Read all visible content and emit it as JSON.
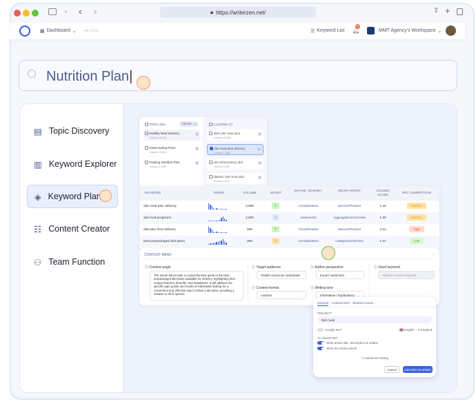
{
  "browser": {
    "url": "https://writerzen.net/"
  },
  "header": {
    "dashboard": "Dashboard",
    "version": "ver. 2.0.0",
    "keyword_list": "Keyword List",
    "keyword_list_count": "12",
    "notif_count": "12",
    "workspace": "MMT Agency's Workspace"
  },
  "search": {
    "value": "Nutrition Plan"
  },
  "sidebar": {
    "items": [
      {
        "label": "Topic Discovery",
        "icon": "topic-discovery-icon"
      },
      {
        "label": "Keyword Explorer",
        "icon": "keyword-explorer-icon"
      },
      {
        "label": "Keyword Plan",
        "icon": "layers-icon"
      },
      {
        "label": "Content Creator",
        "icon": "content-creator-icon"
      },
      {
        "label": "Team Function",
        "icon": "team-icon"
      }
    ]
  },
  "topics": {
    "header": "TOPIC (50)",
    "sort": "Volume",
    "count": "47",
    "items": [
      {
        "name": "Healthy Meal Delivery",
        "volume": "Volume: 28,131"
      },
      {
        "name": "Clean Eating Plans",
        "volume": "Volume: 18,631"
      },
      {
        "name": "Training Nutrition Plan",
        "volume": "Volume: 10,540"
      }
    ]
  },
  "clusters": {
    "header": "CLUSTER (7)",
    "items": [
      {
        "name": "dash diet meal plan",
        "volume": "Volume: 15,634",
        "checked": false
      },
      {
        "name": "diet meal plan delivery",
        "volume": "Volume: 7,298",
        "checked": true
      },
      {
        "name": "anti inflammatory diet",
        "volume": "Volume: 4,298",
        "checked": false
      },
      {
        "name": "diabetic diet meal plan",
        "volume": "Volume: 1,210",
        "checked": false
      }
    ]
  },
  "table": {
    "headers": [
      "KEYWORD",
      "TREND",
      "VOLUME",
      "INTENT",
      "BUYING JOURNEY",
      "MICRO INTENT",
      "GOLDEN SCORE",
      "PPC COMPETITION"
    ],
    "rows": [
      {
        "keyword": "diet meal plan delivery",
        "trend": [
          9,
          7,
          5,
          2,
          1,
          2,
          1,
          1,
          1,
          1,
          1,
          1
        ],
        "volume": "3,880",
        "intent": "T",
        "journey": "Consideration",
        "micro": "Service/Product",
        "score": "1.43",
        "ppc": "Medium"
      },
      {
        "keyword": "diet food programs",
        "trend": [
          1,
          1,
          1,
          1,
          1,
          1,
          1,
          2,
          5,
          7,
          4,
          2
        ],
        "volume": "2,500",
        "intent": "I",
        "journey": "Awareness",
        "micro": "Aggregation/Overview",
        "score": "1.25",
        "ppc": "Medium"
      },
      {
        "keyword": "diet plan food delivery",
        "trend": [
          9,
          7,
          5,
          2,
          1,
          2,
          1,
          1,
          1,
          1,
          1,
          1
        ],
        "volume": "590",
        "intent": "T",
        "journey": "Consideration",
        "micro": "Service/Product",
        "score": "2.01",
        "ppc": "High"
      },
      {
        "keyword": "best prepackaged diet plans",
        "trend": [
          1,
          2,
          2,
          3,
          3,
          4,
          4,
          5,
          6,
          8,
          5,
          3
        ],
        "volume": "260",
        "intent": "C",
        "journey": "Consideration",
        "micro": "Category/Selection",
        "score": "1.07",
        "ppc": "Low"
      }
    ]
  },
  "colors": {
    "accent": "#3b63e0",
    "intent_T": "#c9f5c0",
    "intent_I": "#d8e5fb",
    "intent_C": "#ffe0a3",
    "ppc_Medium": "#ffe0a3",
    "ppc_High": "#ffd9d0",
    "ppc_Low": "#d6f7cf"
  },
  "brief": {
    "title": "CONTENT BRIEF",
    "angle_label": "Content angle",
    "angle": "The article will provide a comprehensive guide to the best prepackaged diet plans available for delivery, highlighting their unique features, benefits, and drawbacks. It will address the specific pain points and needs of individuals looking for a convenient and effective way to follow a diet plan, providing a solution to their queries.",
    "audience_label": "Target audience",
    "audience": "Health-conscious individuals",
    "perspective_label": "Author perspective",
    "perspective": "Expert nutritionist",
    "seed_label": "Seed keyword",
    "seed_placeholder": "Highest-volume keyword",
    "format_label": "Content format",
    "format": "Listicles",
    "tone_label": "Writing tone",
    "tone": "Informative / Explanatory"
  },
  "popup": {
    "tabs": [
      "General",
      "Content brief",
      "Shared Access"
    ],
    "project_label": "PROJECT",
    "project": "Diet meal",
    "nlp": "Google NLP",
    "language": "English",
    "region": "England",
    "ai_label": "AI ASSISTANT",
    "opt1": "Write article title, description & outline",
    "opt2": "Write the whole article",
    "advanced": "Advanced setting",
    "cancel": "Cancel",
    "submit": "Auto-write 18 articles"
  }
}
